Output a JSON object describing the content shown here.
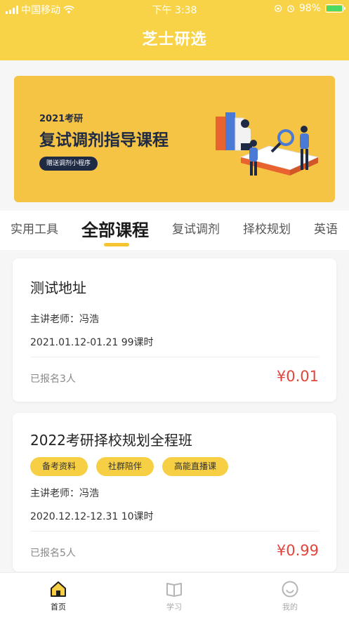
{
  "status_bar": {
    "carrier": "中国移动",
    "time": "下午 3:38",
    "battery": "98%"
  },
  "nav": {
    "title": "芝士研选"
  },
  "banner": {
    "year": "2021考研",
    "headline": "复试调剂指导课程",
    "pill": "赠送调剂小程序"
  },
  "tabs": [
    {
      "label": "实用工具"
    },
    {
      "label": "全部课程"
    },
    {
      "label": "复试调剂"
    },
    {
      "label": "择校规划"
    },
    {
      "label": "英语"
    }
  ],
  "courses": [
    {
      "title": "测试地址",
      "teacher": "主讲老师：冯浩",
      "date": "2021.01.12-01.21 99课时",
      "enrolled": "已报名3人",
      "price": "¥0.01"
    },
    {
      "title": "2022考研择校规划全程班",
      "tags": [
        "备考资料",
        "社群陪伴",
        "高能直播课"
      ],
      "teacher": "主讲老师：冯浩",
      "date": "2020.12.12-12.31 10课时",
      "enrolled": "已报名5人",
      "price": "¥0.99"
    }
  ],
  "bottom_nav": [
    {
      "label": "首页",
      "icon": "home-icon"
    },
    {
      "label": "学习",
      "icon": "book-icon"
    },
    {
      "label": "我的",
      "icon": "profile-icon"
    }
  ],
  "colors": {
    "brand_yellow": "#f8d347",
    "price_red": "#e2453c",
    "tag_yellow": "#f6cf45",
    "banner_navy": "#1f2a44"
  }
}
